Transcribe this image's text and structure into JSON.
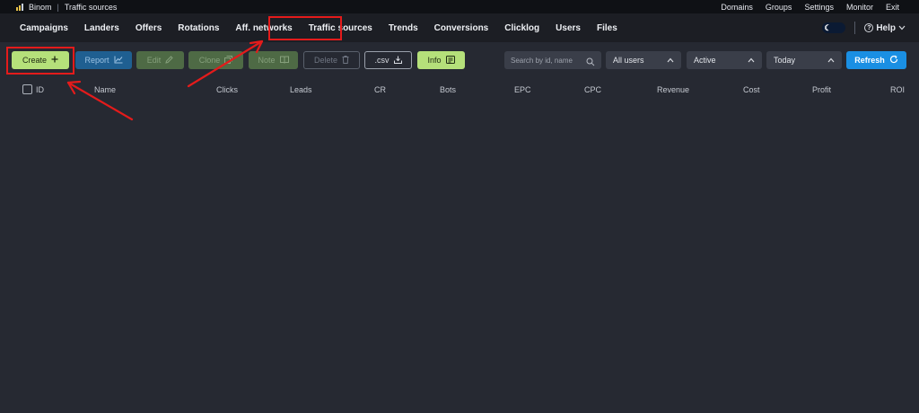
{
  "topbar": {
    "brand": "Binom",
    "page": "Traffic sources",
    "links": [
      "Domains",
      "Groups",
      "Settings",
      "Monitor",
      "Exit"
    ]
  },
  "nav": {
    "items": [
      "Campaigns",
      "Landers",
      "Offers",
      "Rotations",
      "Aff. networks",
      "Traffic sources",
      "Trends",
      "Conversions",
      "Clicklog",
      "Users",
      "Files"
    ],
    "active": "Traffic sources",
    "help_label": "Help"
  },
  "toolbar": {
    "create": "Create",
    "report": "Report",
    "edit": "Edit",
    "clone": "Clone",
    "note": "Note",
    "delete": "Delete",
    "csv": ".csv",
    "info": "Info",
    "refresh": "Refresh",
    "search_placeholder": "Search by id, name",
    "users_filter": "All users",
    "status_filter": "Active",
    "date_filter": "Today"
  },
  "table": {
    "columns": [
      "ID",
      "Name",
      "Clicks",
      "Leads",
      "CR",
      "Bots",
      "EPC",
      "CPC",
      "Revenue",
      "Cost",
      "Profit",
      "ROI"
    ]
  },
  "colors": {
    "accent_green": "#b5e07a",
    "accent_blue": "#1a8fe3",
    "annotation_red": "#e41b1b"
  }
}
